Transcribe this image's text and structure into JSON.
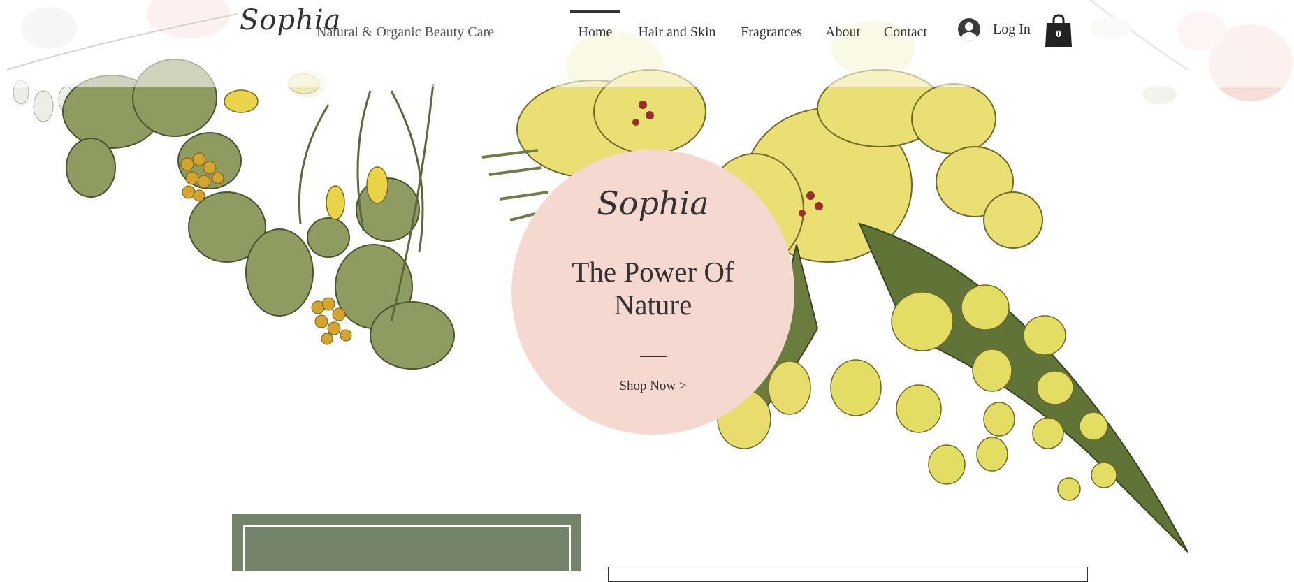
{
  "header": {
    "brand": "Sophia",
    "tagline": "Natural & Organic Beauty Care",
    "nav": [
      {
        "label": "Home",
        "active": true
      },
      {
        "label": "Hair and Skin",
        "active": false
      },
      {
        "label": "Fragrances",
        "active": false
      },
      {
        "label": "About",
        "active": false
      },
      {
        "label": "Contact",
        "active": false
      }
    ],
    "login_label": "Log In",
    "cart_count": "0"
  },
  "hero": {
    "script": "Sophia",
    "title_line1": "The Power Of",
    "title_line2": "Nature",
    "cta": "Shop Now >"
  },
  "colors": {
    "hero_circle": "#f5d9d0",
    "green_panel": "#75836b",
    "text": "#333333",
    "flower_yellow": "#eadf72",
    "leaf_green": "#8e9c62",
    "blossom_pink": "#f0c3b8"
  },
  "icons": {
    "account": "user-avatar-icon",
    "cart": "shopping-bag-icon"
  }
}
